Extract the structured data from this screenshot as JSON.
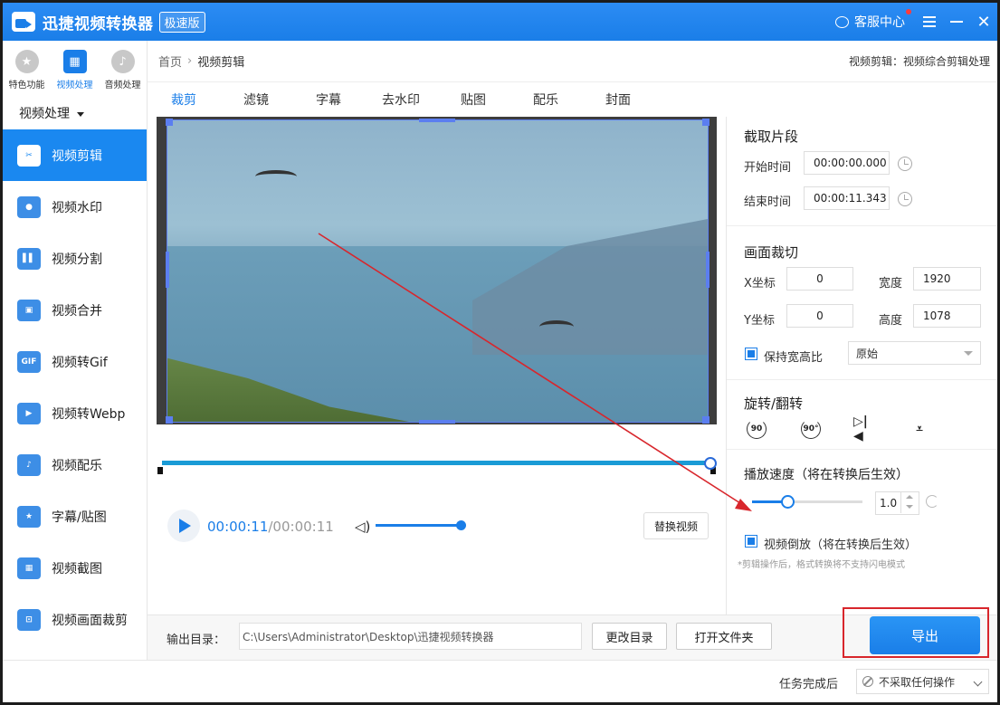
{
  "app": {
    "title": "迅捷视频转换器",
    "badge": "极速版",
    "service": "客服中心",
    "colors": {
      "brand": "#1a7ee8",
      "sidebar_active": "#1a88f0",
      "annotation": "#d8262c"
    }
  },
  "sidebar": {
    "categories": [
      {
        "label": "特色功能",
        "icon": "star-icon"
      },
      {
        "label": "视频处理",
        "icon": "film-icon"
      },
      {
        "label": "音频处理",
        "icon": "audio-icon"
      }
    ],
    "dropdown": "视频处理",
    "items": [
      {
        "label": "视频剪辑",
        "icon": "clip-icon",
        "glyph": "✂"
      },
      {
        "label": "视频水印",
        "icon": "watermark-icon",
        "glyph": "●"
      },
      {
        "label": "视频分割",
        "icon": "split-icon",
        "glyph": "▌▌"
      },
      {
        "label": "视频合并",
        "icon": "merge-icon",
        "glyph": "▣"
      },
      {
        "label": "视频转Gif",
        "icon": "gif-icon",
        "glyph": "GIF"
      },
      {
        "label": "视频转Webp",
        "icon": "webp-icon",
        "glyph": "▶"
      },
      {
        "label": "视频配乐",
        "icon": "music-icon",
        "glyph": "♪"
      },
      {
        "label": "字幕/贴图",
        "icon": "sticker-icon",
        "glyph": "★"
      },
      {
        "label": "视频截图",
        "icon": "screenshot-icon",
        "glyph": "▦"
      },
      {
        "label": "视频画面裁剪",
        "icon": "crop-icon",
        "glyph": "⊡"
      }
    ]
  },
  "breadcrumb": {
    "home": "首页",
    "sep": "›",
    "current": "视频剪辑",
    "right": "视频剪辑：视频综合剪辑处理"
  },
  "tabs": [
    "裁剪",
    "滤镜",
    "字幕",
    "去水印",
    "贴图",
    "配乐",
    "封面"
  ],
  "player": {
    "time_current": "00:00:11",
    "time_total": "/00:00:11",
    "replace": "替换视频",
    "volume": 1.0
  },
  "clip": {
    "title": "截取片段",
    "start_label": "开始时间",
    "start_value": "00:00:00.000",
    "end_label": "结束时间",
    "end_value": "00:00:11.343"
  },
  "crop": {
    "title": "画面裁切",
    "x_label": "X坐标",
    "x_value": "0",
    "y_label": "Y坐标",
    "y_value": "0",
    "w_label": "宽度",
    "w_value": "1920",
    "h_label": "高度",
    "h_value": "1078",
    "keep_ratio": "保持宽高比",
    "ratio_select": "原始"
  },
  "rotate": {
    "title": "旋转/翻转",
    "ccw_label": "90",
    "cw_label": "90°"
  },
  "speed": {
    "title": "播放速度（将在转换后生效）",
    "value": "1.0",
    "slider_fraction": 0.25
  },
  "reverse": {
    "label": "视频倒放（将在转换后生效）",
    "note": "*剪辑操作后，格式转换将不支持闪电模式"
  },
  "output": {
    "label": "输出目录：",
    "path": "C:\\Users\\Administrator\\Desktop\\迅捷视频转换器",
    "change_dir": "更改目录",
    "open_folder": "打开文件夹",
    "export": "导出"
  },
  "footer": {
    "label": "任务完成后",
    "select": "不采取任何操作"
  }
}
